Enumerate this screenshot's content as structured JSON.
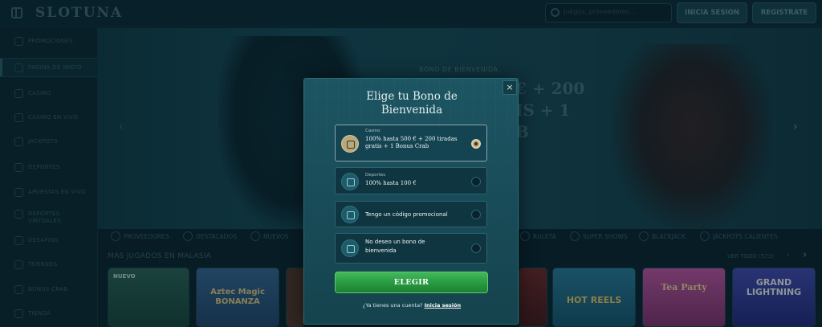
{
  "topbar": {
    "logo_text": "SLOTUNA",
    "search_placeholder": "Juegos, proveedores...",
    "login_label": "INICIA SESION",
    "register_label": "REGISTRATE"
  },
  "sidebar": {
    "items": [
      {
        "label": "PROMOCIONES"
      },
      {
        "label": "PAGINA DE INICIO"
      },
      {
        "label": "CASINO"
      },
      {
        "label": "CASINO EN VIVO"
      },
      {
        "label": "JACKPOTS"
      },
      {
        "label": "DEPORTES"
      },
      {
        "label": "APUESTAS EN VIVO"
      },
      {
        "label": "DEPORTES VIRTUALES"
      },
      {
        "label": "DESAFIOS"
      },
      {
        "label": "TORNEOS"
      },
      {
        "label": "BONUS CRAB"
      },
      {
        "label": "TIENDA"
      }
    ]
  },
  "hero": {
    "label": "BONO DE BIENVENIDA",
    "title_line1": "€ + 200",
    "title_line2": "IS + 1",
    "title_line3": "B"
  },
  "categories": {
    "items": [
      {
        "label": "PROVEEDORES"
      },
      {
        "label": "DESTACADOS"
      },
      {
        "label": "NUEVOS"
      },
      {
        "label": "RULETA"
      },
      {
        "label": "SUPER SHOWS"
      },
      {
        "label": "BLACKJACK"
      },
      {
        "label": "JACKPOTS CALIENTES"
      }
    ]
  },
  "games_row": {
    "title": "MÁS JUGADOS EN MALASIA",
    "more_label": "VER TODO (573)",
    "games": [
      {
        "title": "NUEVO",
        "color": "#2a5a4a"
      },
      {
        "title": "Aztec Magic BONANZA",
        "color": "#3a5d8a"
      },
      {
        "title": "",
        "color": "#5a3a2a"
      },
      {
        "title": "",
        "color": "#6a2a2a"
      },
      {
        "title": "HOT REELS",
        "color": "#2c7a9a"
      },
      {
        "title": "Tea Party",
        "color": "#b94a9a"
      },
      {
        "title": "GRAND LIGHTNING",
        "color": "#3a3fa0"
      }
    ]
  },
  "modal": {
    "title": "Elige tu Bono de Bienvenida",
    "close_label": "×",
    "options": [
      {
        "category": "Casino",
        "text": "100% hasta 500 € + 200 tiradas gratis + 1 Bonus Crab",
        "selected": true
      },
      {
        "category": "Deportes",
        "text": "100% hasta 100 €",
        "selected": false
      },
      {
        "category": "",
        "text": "Tengo un código promocional",
        "selected": false
      },
      {
        "category": "",
        "text": "No deseo un bono de bienvenida",
        "selected": false
      }
    ],
    "choose_label": "ELEGIR",
    "footer_prompt": "¿Ya tienes una cuenta?",
    "footer_link": "Inicia sesión"
  },
  "colors": {
    "accent_green": "#2a9e44",
    "selected_gold": "#b8a47a",
    "background": "#0c2630"
  }
}
